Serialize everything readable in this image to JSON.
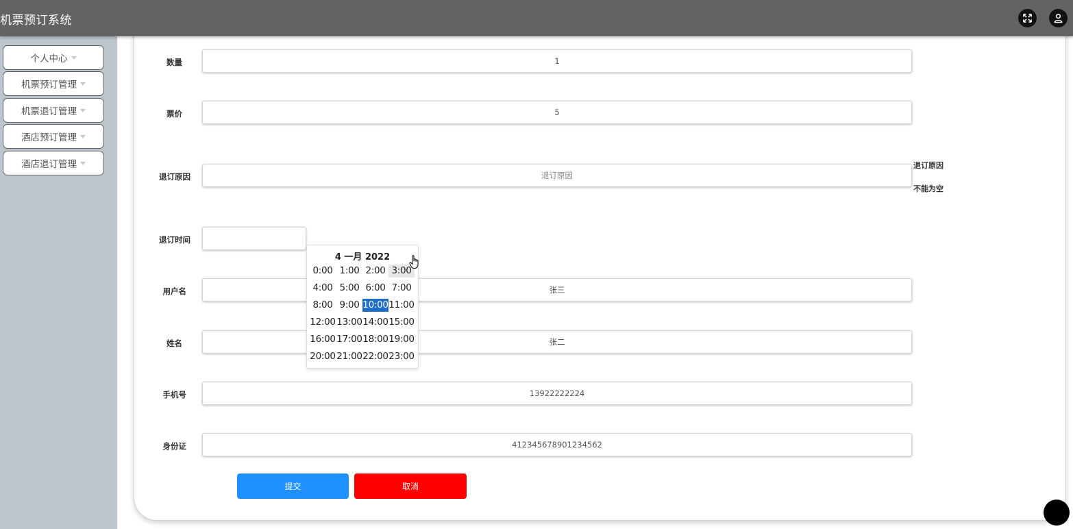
{
  "header": {
    "title": "机票预订系统"
  },
  "sidebar": {
    "items": [
      {
        "label": "个人中心"
      },
      {
        "label": "机票预订管理"
      },
      {
        "label": "机票退订管理"
      },
      {
        "label": "酒店预订管理"
      },
      {
        "label": "酒店退订管理"
      }
    ]
  },
  "form": {
    "quantity": {
      "label": "数量",
      "value": "1"
    },
    "price": {
      "label": "票价",
      "value": "5"
    },
    "reason": {
      "label": "退订原因",
      "placeholder": "退订原因",
      "error_line1": "退订原因",
      "error_line2": "不能为空"
    },
    "refund_time": {
      "label": "退订时间",
      "value": ""
    },
    "username": {
      "label": "用户名",
      "value": "张三"
    },
    "name": {
      "label": "姓名",
      "value": "张二"
    },
    "phone": {
      "label": "手机号",
      "value": "13922222224"
    },
    "id_card": {
      "label": "身份证",
      "value": "412345678901234562"
    },
    "submit_label": "提交",
    "cancel_label": "取消"
  },
  "datepicker": {
    "title": "4 一月 2022",
    "hours": [
      "0:00",
      "1:00",
      "2:00",
      "3:00",
      "4:00",
      "5:00",
      "6:00",
      "7:00",
      "8:00",
      "9:00",
      "10:00",
      "11:00",
      "12:00",
      "13:00",
      "14:00",
      "15:00",
      "16:00",
      "17:00",
      "18:00",
      "19:00",
      "20:00",
      "21:00",
      "22:00",
      "23:00"
    ],
    "selected": "10:00",
    "hovered": "3:00"
  },
  "colors": {
    "topbar": "#636366",
    "submit": "#1e90ff",
    "cancel": "#ff0000",
    "selected_hour": "#1f6ec7"
  }
}
